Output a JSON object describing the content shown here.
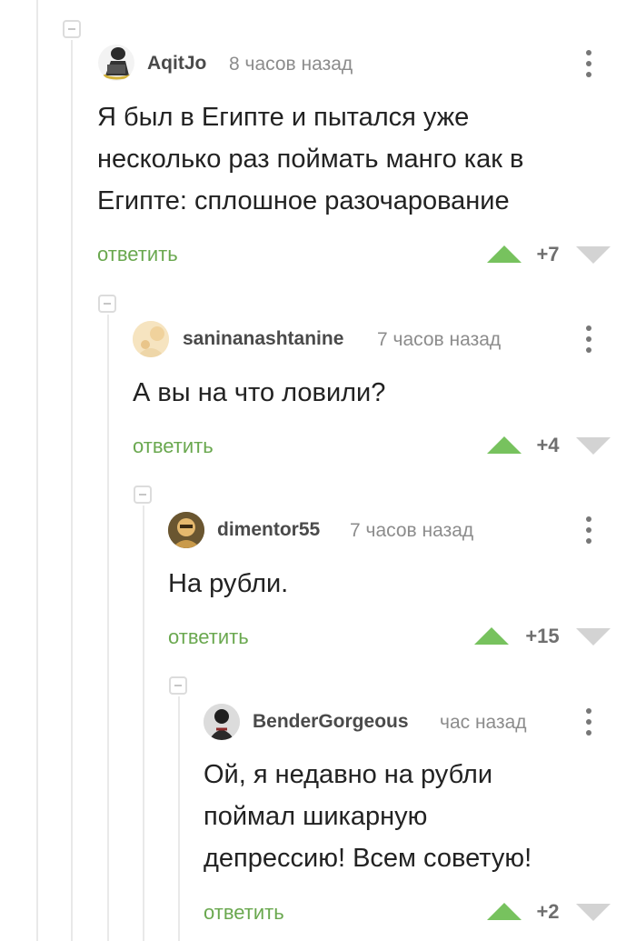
{
  "comments": [
    {
      "author": "AqitJo",
      "time": "8 часов назад",
      "text_lines": [
        "Я был в Египте и пытался уже",
        "несколько раз поймать манго как в",
        "Египте: сплошное разочарование"
      ],
      "reply_label": "ответить",
      "score": "+7"
    },
    {
      "author": "saninanashtanine",
      "time": "7 часов назад",
      "text_lines": [
        "А вы на что ловили?"
      ],
      "reply_label": "ответить",
      "score": "+4"
    },
    {
      "author": "dimentor55",
      "time": "7 часов назад",
      "text_lines": [
        "На рубли."
      ],
      "reply_label": "ответить",
      "score": "+15"
    },
    {
      "author": "BenderGorgeous",
      "time": "час назад",
      "text_lines": [
        "Ой, я недавно на рубли",
        "поймал шикарную",
        "депрессию! Всем советую!"
      ],
      "reply_label": "ответить",
      "score": "+2"
    }
  ],
  "colors": {
    "reply": "#6aa84f",
    "upvote": "#77c25e",
    "downvote": "#d3d3d3",
    "thread_line": "#e9e9e9"
  }
}
